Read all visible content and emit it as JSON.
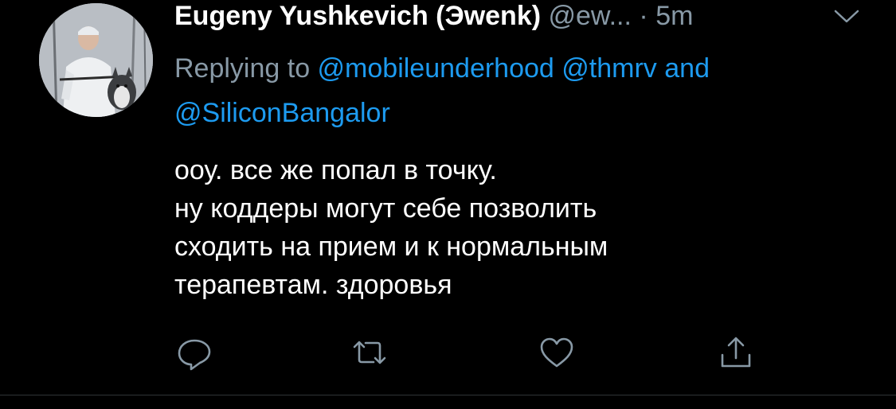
{
  "tweet": {
    "display_name": "Eugeny Yushkevich (Эwenk)",
    "handle": "@ew...",
    "dot": "·",
    "time": "5m",
    "replying_to_prefix": "Replying to ",
    "mentions": [
      "@mobileunderhood",
      "@thmrv",
      "@SiliconBangalor"
    ],
    "and_word": "and",
    "text_lines": [
      "ооу. все же попал в точку.",
      "ну коддеры могут себе позволить",
      "сходить на прием и к нормальным",
      "терапевтам. здоровья"
    ]
  },
  "actions": {
    "icons": [
      "reply-icon",
      "retweet-icon",
      "like-icon",
      "share-icon"
    ]
  },
  "colors": {
    "background": "#000000",
    "text": "#ffffff",
    "secondary": "#8899a6",
    "accent": "#1d9bf0"
  }
}
